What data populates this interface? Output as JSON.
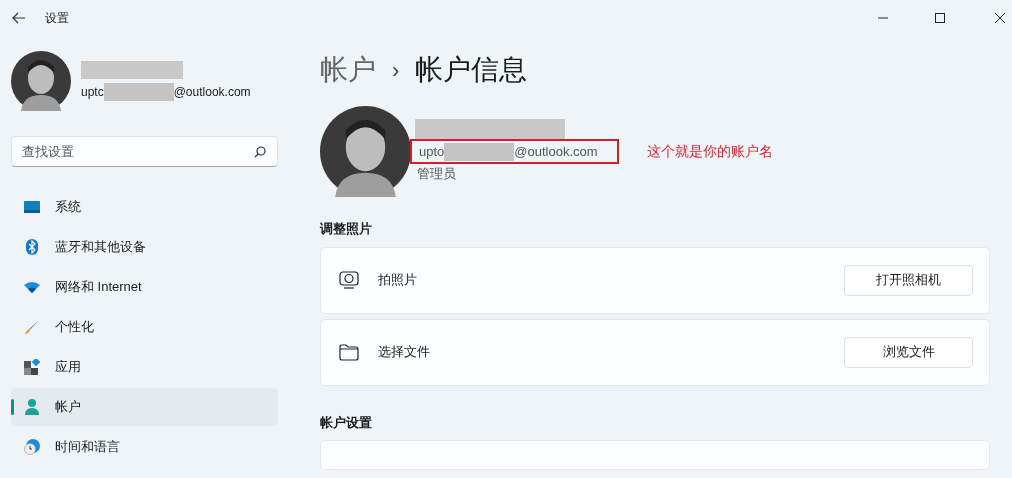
{
  "window": {
    "title": "设置"
  },
  "sidebar": {
    "account": {
      "email_prefix": "uptc",
      "email_suffix": "@outlook.com"
    },
    "search": {
      "placeholder": "查找设置"
    },
    "items": [
      {
        "label": "系统",
        "kind": "system",
        "selected": false
      },
      {
        "label": "蓝牙和其他设备",
        "kind": "bluetooth",
        "selected": false
      },
      {
        "label": "网络和 Internet",
        "kind": "network",
        "selected": false
      },
      {
        "label": "个性化",
        "kind": "brush",
        "selected": false
      },
      {
        "label": "应用",
        "kind": "apps",
        "selected": false
      },
      {
        "label": "帐户",
        "kind": "account",
        "selected": true
      },
      {
        "label": "时间和语言",
        "kind": "time",
        "selected": false
      }
    ]
  },
  "breadcrumb": {
    "parent": "帐户",
    "separator": "›",
    "current": "帐户信息"
  },
  "profile": {
    "email_prefix": "upto",
    "email_suffix": "@outlook.com",
    "role": "管理员",
    "annotation": "这个就是你的账户名"
  },
  "sections": [
    {
      "title": "调整照片",
      "rows": [
        {
          "kind": "camera",
          "label": "拍照片",
          "button": "打开照相机"
        },
        {
          "kind": "folder",
          "label": "选择文件",
          "button": "浏览文件"
        }
      ]
    },
    {
      "title": "帐户设置"
    }
  ]
}
